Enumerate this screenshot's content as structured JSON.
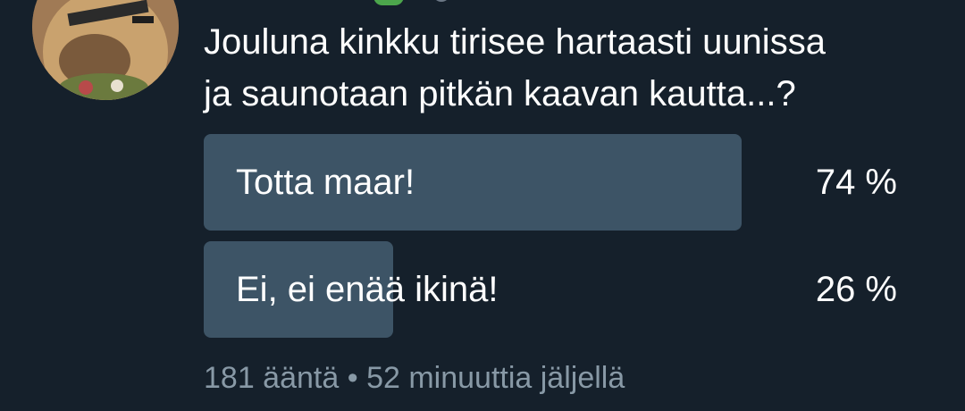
{
  "poll": {
    "question": "Jouluna kinkku tirisee hartaasti uunissa\nja saunotaan pitkän kaavan kautta...?",
    "options": [
      {
        "label": "Totta maar!",
        "percent_text": "74 %",
        "percent": 74
      },
      {
        "label": "Ei, ei enää ikinä!",
        "percent_text": "26 %",
        "percent": 26
      }
    ],
    "votes_text": "181 ääntä",
    "separator": "•",
    "time_left_text": "52 minuuttia jäljellä"
  },
  "colors": {
    "background": "#15202b",
    "bar": "#3d5466",
    "text": "#ffffff",
    "meta": "#8899a6"
  }
}
